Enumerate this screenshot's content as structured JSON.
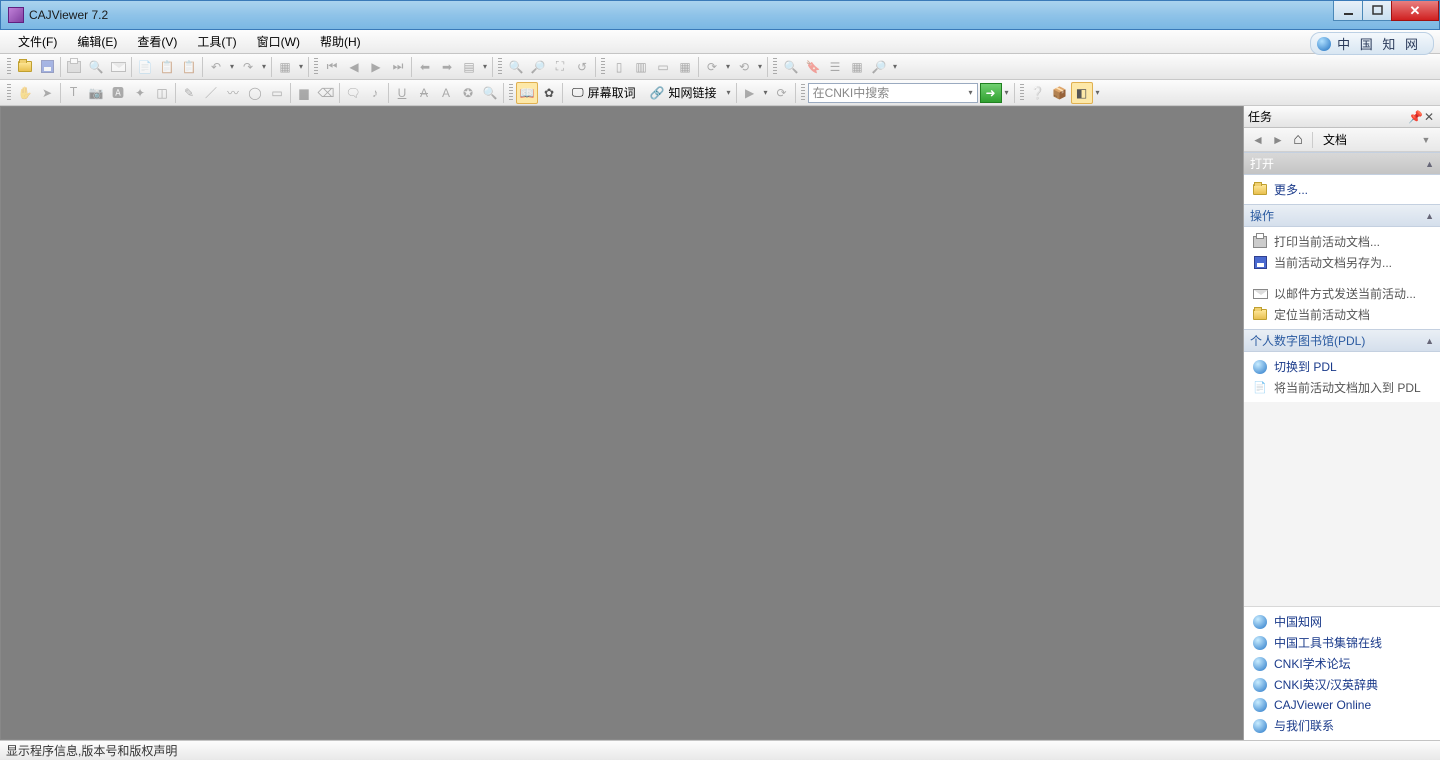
{
  "window": {
    "title": "CAJViewer 7.2"
  },
  "menu": {
    "file": "文件(F)",
    "edit": "编辑(E)",
    "view": "查看(V)",
    "tools": "工具(T)",
    "window": "窗口(W)",
    "help": "帮助(H)"
  },
  "brand": "中 国 知 网",
  "toolbar3": {
    "screen_capture": "屏幕取词",
    "cnki_link": "知网链接",
    "search_placeholder": "在CNKI中搜索"
  },
  "taskpane": {
    "title": "任务",
    "doc_tab": "文档",
    "sections": {
      "open": {
        "header": "打开",
        "more": "更多..."
      },
      "ops": {
        "header": "操作",
        "print": "打印当前活动文档...",
        "saveas": "当前活动文档另存为...",
        "mail": "以邮件方式发送当前活动...",
        "locate": "定位当前活动文档"
      },
      "pdl": {
        "header": "个人数字图书馆(PDL)",
        "switch": "切换到 PDL",
        "add": "将当前活动文档加入到 PDL"
      }
    },
    "links": {
      "cnki": "中国知网",
      "toolbook": "中国工具书集锦在线",
      "forum": "CNKI学术论坛",
      "dict": "CNKI英汉/汉英辞典",
      "online": "CAJViewer Online",
      "contact": "与我们联系"
    }
  },
  "statusbar": "显示程序信息,版本号和版权声明"
}
